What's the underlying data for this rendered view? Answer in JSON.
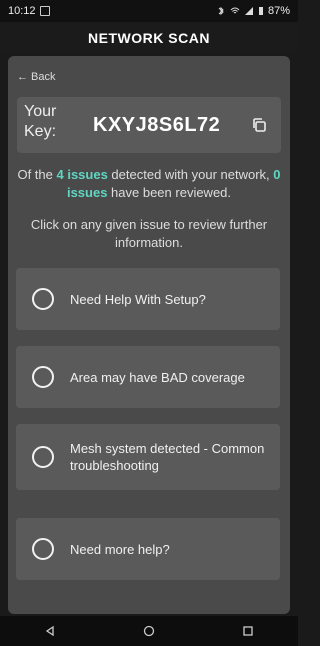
{
  "status": {
    "time": "10:12",
    "battery": "87%"
  },
  "header": {
    "title": "NETWORK SCAN"
  },
  "nav": {
    "back_label": "← Back"
  },
  "key": {
    "label": "Your Key:",
    "value": "KXYJ8S6L72",
    "copy_icon": "copy-icon"
  },
  "summary": {
    "prefix": "Of the ",
    "issues_detected": "4 issues",
    "middle": " detected with your network, ",
    "issues_reviewed": "0 issues",
    "suffix": " have been reviewed.",
    "instruction": "Click on any given issue to review further information."
  },
  "issues": [
    {
      "label": "Need Help With Setup?"
    },
    {
      "label": "Area may have BAD coverage"
    },
    {
      "label": "Mesh system detected - Common troubleshooting"
    },
    {
      "label": "Need more help?"
    }
  ],
  "system_nav": {
    "back_icon": "triangle-back-icon",
    "home_icon": "circle-home-icon",
    "recents_icon": "square-recents-icon"
  }
}
